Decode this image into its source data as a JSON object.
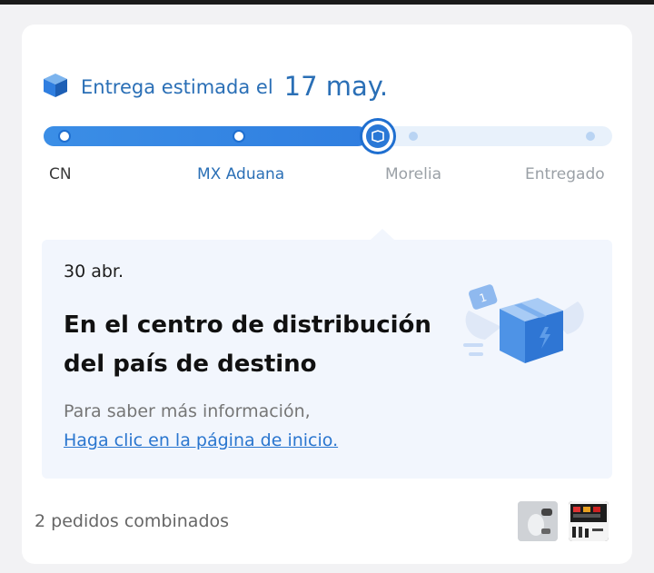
{
  "estimate": {
    "label": "Entrega estimada el",
    "date": "17 may."
  },
  "progress": {
    "fraction": 0.57,
    "stages": [
      {
        "label": "CN",
        "state": "done"
      },
      {
        "label": "MX Aduana",
        "state": "done"
      },
      {
        "label": "",
        "state": "current"
      },
      {
        "label": "Morelia",
        "state": "pending"
      },
      {
        "label": "Entregado",
        "state": "pending"
      }
    ]
  },
  "event": {
    "date": "30 abr.",
    "title": "En el centro de distribución del país de destino",
    "info": "Para saber más información,",
    "link": "Haga clic en la página de inicio."
  },
  "footer": {
    "combined": "2 pedidos combinados"
  },
  "thumbnails": [
    "product-thumbnail",
    "product-thumbnail"
  ],
  "colors": {
    "accent": "#2a6fb6",
    "track_fill": "#3b8ee6",
    "track_bg": "#e8f1fb",
    "panel_bg": "#f2f6fd"
  },
  "icons": [
    "package-icon",
    "package-in-transit-icon",
    "delivery-box-illustration"
  ]
}
